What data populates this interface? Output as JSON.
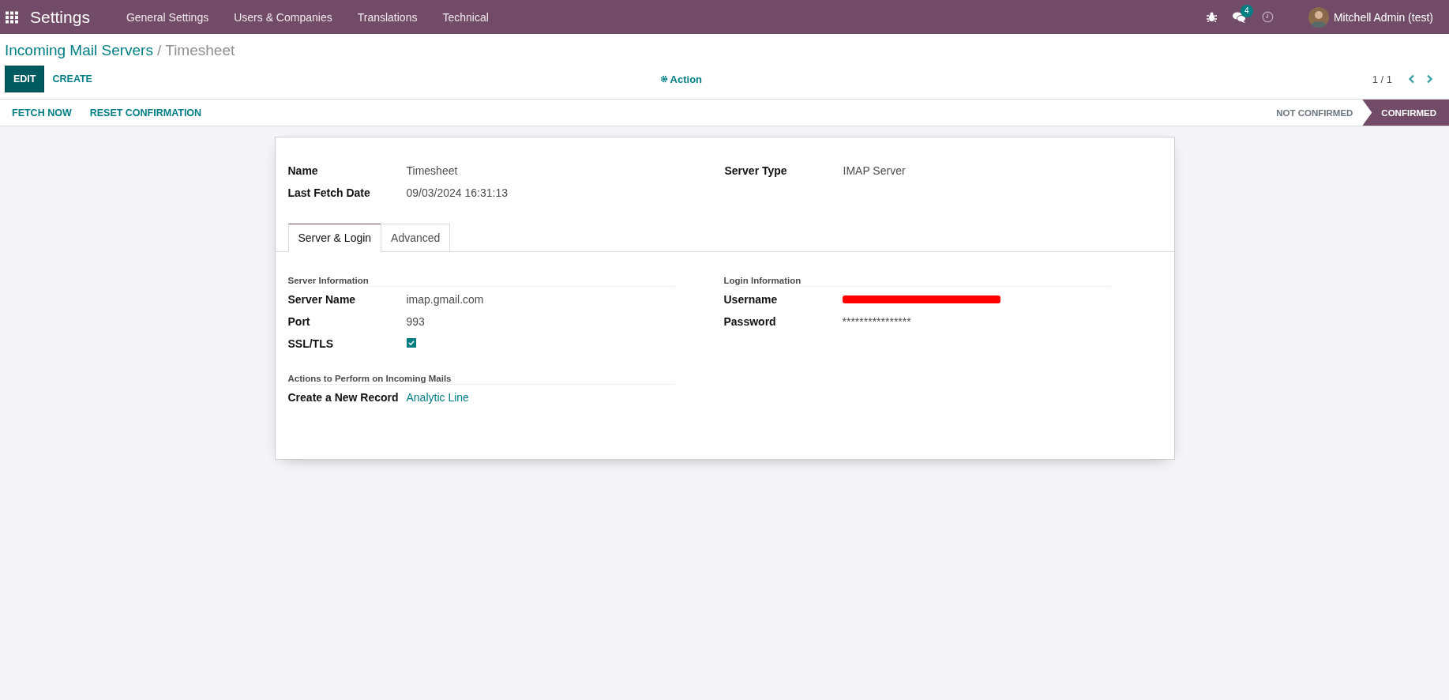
{
  "navbar": {
    "app_title": "Settings",
    "menu": [
      "General Settings",
      "Users & Companies",
      "Translations",
      "Technical"
    ],
    "message_count": "4",
    "user": "Mitchell Admin (test)"
  },
  "breadcrumb": {
    "parent": "Incoming Mail Servers",
    "separator": "/",
    "current": "Timesheet"
  },
  "control_panel": {
    "buttons": [
      {
        "label": "EDIT",
        "kind": "primary"
      },
      {
        "label": "CREATE",
        "kind": "link"
      }
    ],
    "action": "Action",
    "pager": "1 / 1"
  },
  "status_bar": {
    "buttons": [
      "FETCH NOW",
      "RESET CONFIRMATION"
    ],
    "stages": [
      {
        "label": "NOT CONFIRMED",
        "selected": false
      },
      {
        "label": "CONFIRMED",
        "selected": true
      }
    ]
  },
  "form": {
    "left_fields": [
      {
        "label": "Name",
        "value": "Timesheet"
      },
      {
        "label": "Last Fetch Date",
        "value": "09/03/2024 16:31:13"
      }
    ],
    "right_fields": [
      {
        "label": "Server Type",
        "value": "IMAP Server"
      }
    ],
    "tabs": [
      {
        "label": "Server & Login",
        "selected": true
      },
      {
        "label": "Advanced",
        "selected": false
      }
    ],
    "left_groups": [
      {
        "title": "Server Information",
        "fields": [
          {
            "label": "Server Name",
            "kind": "text",
            "value": "imap.gmail.com"
          },
          {
            "label": "Port",
            "kind": "text",
            "value": "993"
          },
          {
            "label": "SSL/TLS",
            "kind": "checkbox",
            "checked": true
          }
        ]
      },
      {
        "title": "Actions to Perform on Incoming Mails",
        "fields": [
          {
            "label": "Create a New Record",
            "kind": "link",
            "value": "Analytic Line"
          }
        ]
      }
    ],
    "right_groups": [
      {
        "title": "Login Information",
        "fields": [
          {
            "label": "Username",
            "kind": "redacted"
          },
          {
            "label": "Password",
            "kind": "text",
            "value": "****************"
          }
        ]
      }
    ]
  }
}
